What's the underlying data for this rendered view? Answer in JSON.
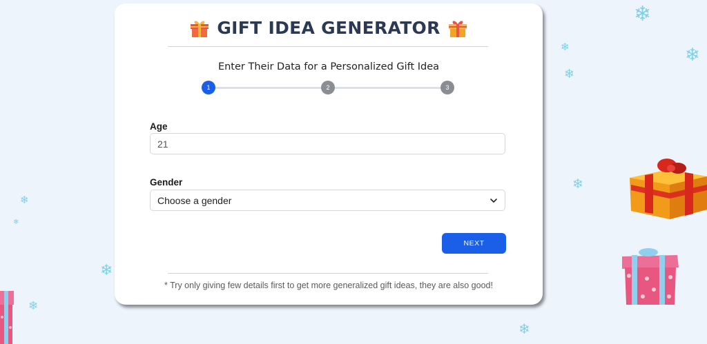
{
  "header": {
    "title": "GIFT IDEA GENERATOR",
    "left_icon": "gift-icon",
    "right_icon": "gift-icon"
  },
  "form": {
    "subtitle": "Enter Their Data for a Personalized Gift Idea",
    "steps": [
      "1",
      "2",
      "3"
    ],
    "active_step": 1,
    "age": {
      "label": "Age",
      "value": "21"
    },
    "gender": {
      "label": "Gender",
      "selected": "Choose a gender"
    },
    "next_label": "NEXT",
    "footnote": "* Try only giving few details first to get more generalized gift ideas, they are also good!"
  },
  "colors": {
    "primary": "#1b5fe8",
    "step_inactive": "#8a8d91",
    "background": "#eef4fc"
  }
}
